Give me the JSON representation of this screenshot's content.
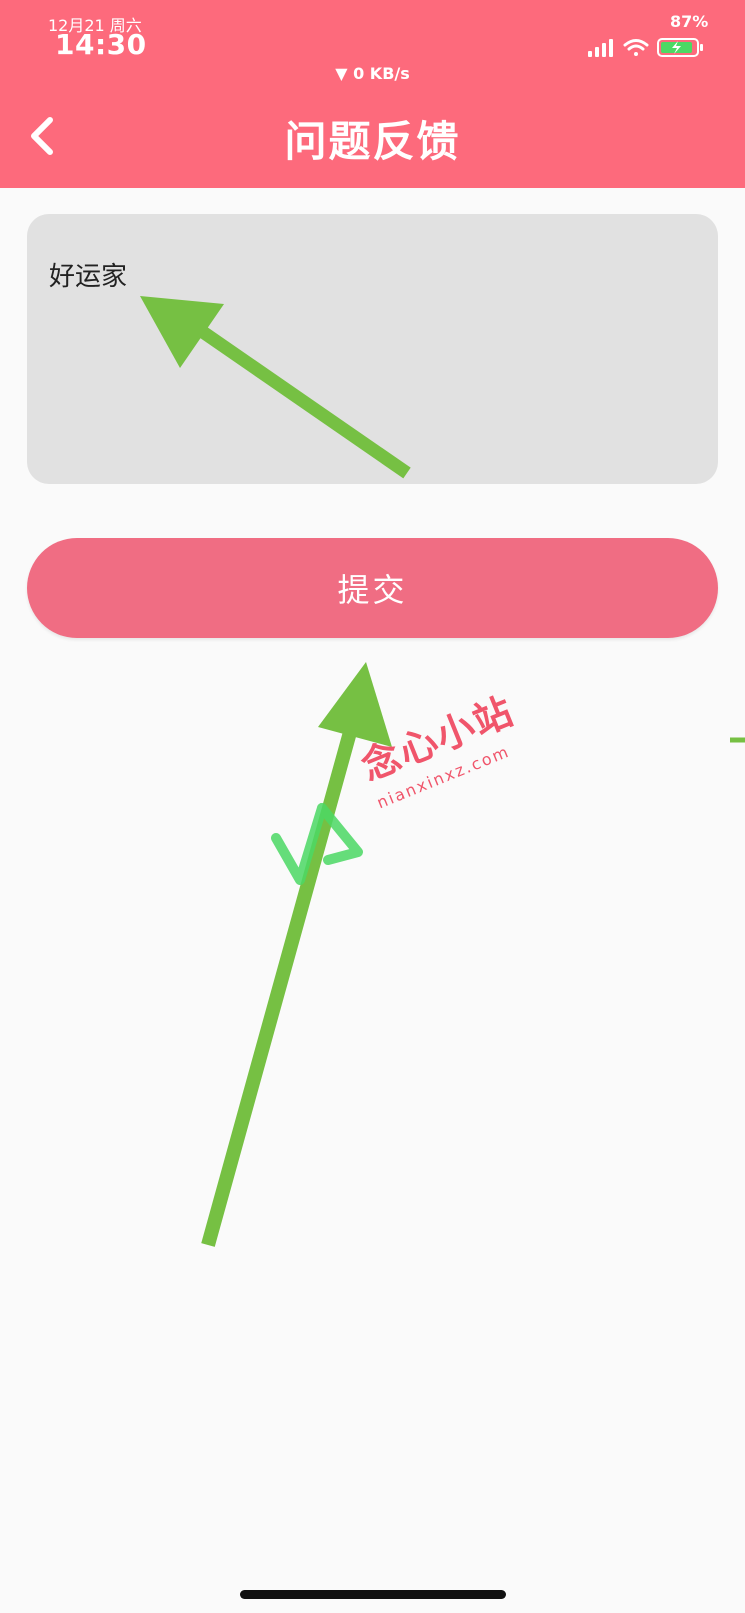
{
  "status_bar": {
    "date": "12月21 周六",
    "time": "14:30",
    "network_speed": "▼ 0 KB/s",
    "battery_percent": "87%",
    "icons": [
      "signal-icon",
      "wifi-icon",
      "battery-charging-icon"
    ]
  },
  "header": {
    "title": "问题反馈",
    "back_icon": "chevron-left-icon"
  },
  "feedback": {
    "value": "好运家"
  },
  "submit": {
    "label": "提交"
  },
  "watermark": {
    "text": "念心小站",
    "url": "nianxinxz.com"
  },
  "colors": {
    "header": "#fd6a7c",
    "button": "#f06d83",
    "input_bg": "#e1e1e1",
    "annotation_arrow": "#76c043",
    "watermark_text": "#f0556b",
    "watermark_logo": "#4cd964"
  }
}
